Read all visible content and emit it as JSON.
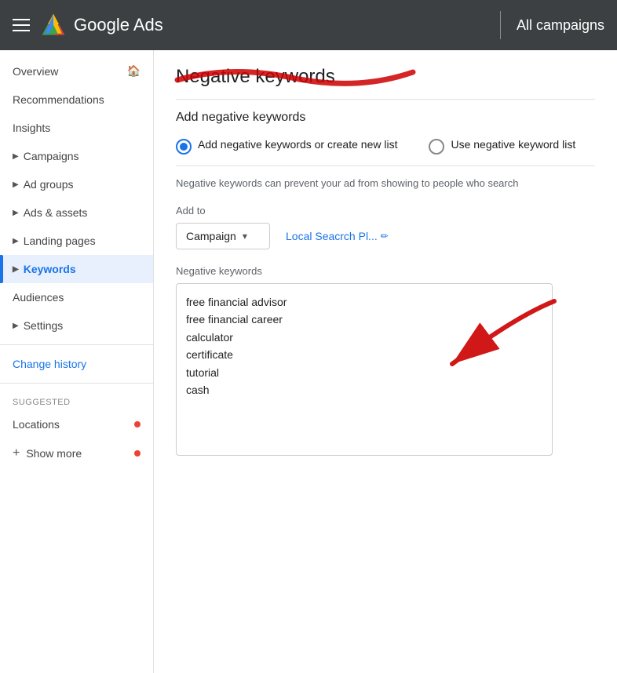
{
  "header": {
    "title": "Google Ads",
    "campaigns_label": "All campaigns",
    "hamburger_icon": "hamburger-icon"
  },
  "sidebar": {
    "items": [
      {
        "label": "Overview",
        "icon": "home-icon",
        "active": false,
        "has_home": true
      },
      {
        "label": "Recommendations",
        "active": false
      },
      {
        "label": "Insights",
        "active": false
      },
      {
        "label": "Campaigns",
        "has_arrow": true,
        "active": false
      },
      {
        "label": "Ad groups",
        "has_arrow": true,
        "active": false
      },
      {
        "label": "Ads & assets",
        "has_arrow": true,
        "active": false
      },
      {
        "label": "Landing pages",
        "has_arrow": true,
        "active": false
      },
      {
        "label": "Keywords",
        "has_arrow": true,
        "active": true
      },
      {
        "label": "Audiences",
        "active": false
      },
      {
        "label": "Settings",
        "has_arrow": true,
        "active": false
      },
      {
        "label": "Change history",
        "active": false,
        "is_link": true
      }
    ],
    "suggested_label": "Suggested",
    "suggested_items": [
      {
        "label": "Locations",
        "has_dot": true
      },
      {
        "label": "Show more",
        "has_dot": true,
        "is_plus": true
      }
    ]
  },
  "main": {
    "page_title": "Negative keywords",
    "section_title": "Add negative keywords",
    "radio_option_1": "Add negative keywords or create new list",
    "radio_option_2": "Use negative keyword list",
    "description": "Negative keywords can prevent your ad from showing to people who search",
    "add_to_label": "Add to",
    "dropdown_label": "Campaign",
    "link_label": "Local Seacrch Pl...",
    "negative_kw_label": "Negative keywords",
    "keywords": "free financial advisor\nfree financial career\ncalculator\ncertificate\ntutorial\ncash"
  }
}
